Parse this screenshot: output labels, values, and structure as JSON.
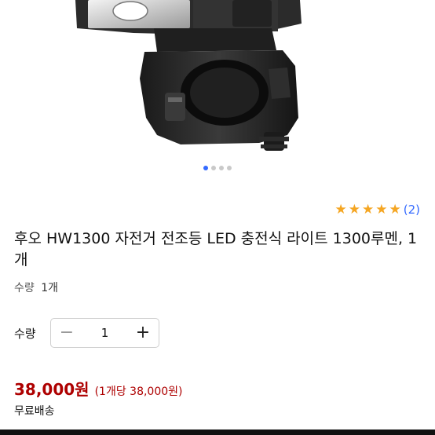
{
  "gallery": {
    "image_icon": "bike-headlight-product-image",
    "dots": [
      true,
      false,
      false,
      false
    ]
  },
  "rating": {
    "stars": 5,
    "review_count": "(2)"
  },
  "product": {
    "title": "후오 HW1300 자전거 전조등 LED 충전식 라이트 1300루멘, 1개",
    "option_label": "수량",
    "option_value": "1개"
  },
  "quantity": {
    "label": "수량",
    "value": "1",
    "minus": "−",
    "plus": "+"
  },
  "price": {
    "amount": "38,000원",
    "unit_price": "(1개당 38,000원)"
  },
  "shipping": {
    "text": "무료배송"
  },
  "colors": {
    "accent": "#346aff",
    "price": "#ae0000",
    "star": "#f5a623"
  }
}
